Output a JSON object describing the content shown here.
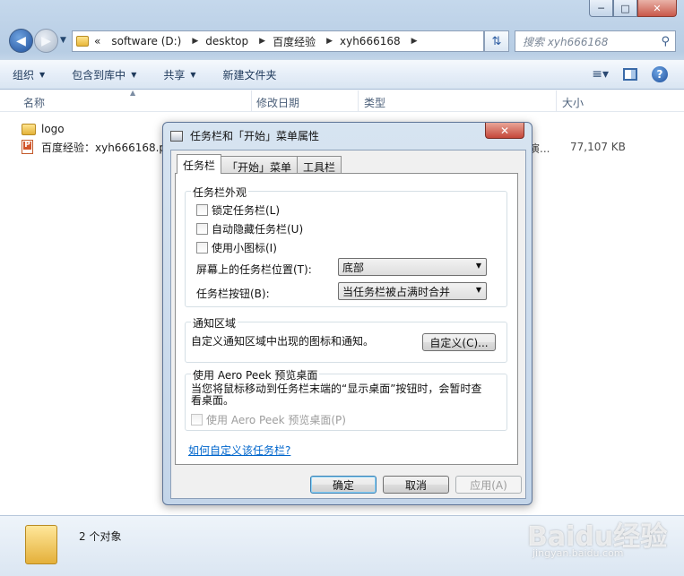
{
  "explorer": {
    "title_controls": {
      "minimize": "─",
      "maximize": "□",
      "close": "✕"
    },
    "nav": {
      "back_icon": "back-arrow-icon",
      "forward_icon": "forward-arrow-icon",
      "crumb_prefix": "«",
      "breadcrumbs": [
        "software (D:)",
        "desktop",
        "百度经验",
        "xyh666168"
      ],
      "search_placeholder": "搜索 xyh666168"
    },
    "toolbar": {
      "organize": "组织",
      "include_in_library": "包含到库中",
      "share": "共享",
      "new_folder": "新建文件夹"
    },
    "columns": {
      "name": "名称",
      "date_modified": "修改日期",
      "type": "类型",
      "size": "大小"
    },
    "files": [
      {
        "name": "logo",
        "icon": "folder-icon"
      },
      {
        "name": "百度经验：xyh666168.pp",
        "icon": "ppt-icon",
        "type_fragment": "演...",
        "size": "77,107 KB"
      }
    ],
    "status": {
      "count": "2 个对象"
    },
    "watermark": {
      "main": "Baidu经验",
      "sub": "jingyan.baidu.com"
    }
  },
  "dialog": {
    "title": "任务栏和「开始」菜单属性",
    "close": "✕",
    "tabs": [
      "任务栏",
      "「开始」菜单",
      "工具栏"
    ],
    "appearance": {
      "title": "任务栏外观",
      "lock": "锁定任务栏(L)",
      "autohide": "自动隐藏任务栏(U)",
      "small_icons": "使用小图标(I)",
      "position_label": "屏幕上的任务栏位置(T):",
      "position_value": "底部",
      "buttons_label": "任务栏按钮(B):",
      "buttons_value": "当任务栏被占满时合并"
    },
    "notification": {
      "title": "通知区域",
      "text": "自定义通知区域中出现的图标和通知。",
      "customize": "自定义(C)..."
    },
    "aero": {
      "title": "使用 Aero Peek 预览桌面",
      "text": "当您将鼠标移动到任务栏末端的“显示桌面”按钮时，会暂时查看桌面。",
      "checkbox": "使用 Aero Peek 预览桌面(P)"
    },
    "help_link": "如何自定义该任务栏?",
    "buttons": {
      "ok": "确定",
      "cancel": "取消",
      "apply": "应用(A)"
    }
  }
}
